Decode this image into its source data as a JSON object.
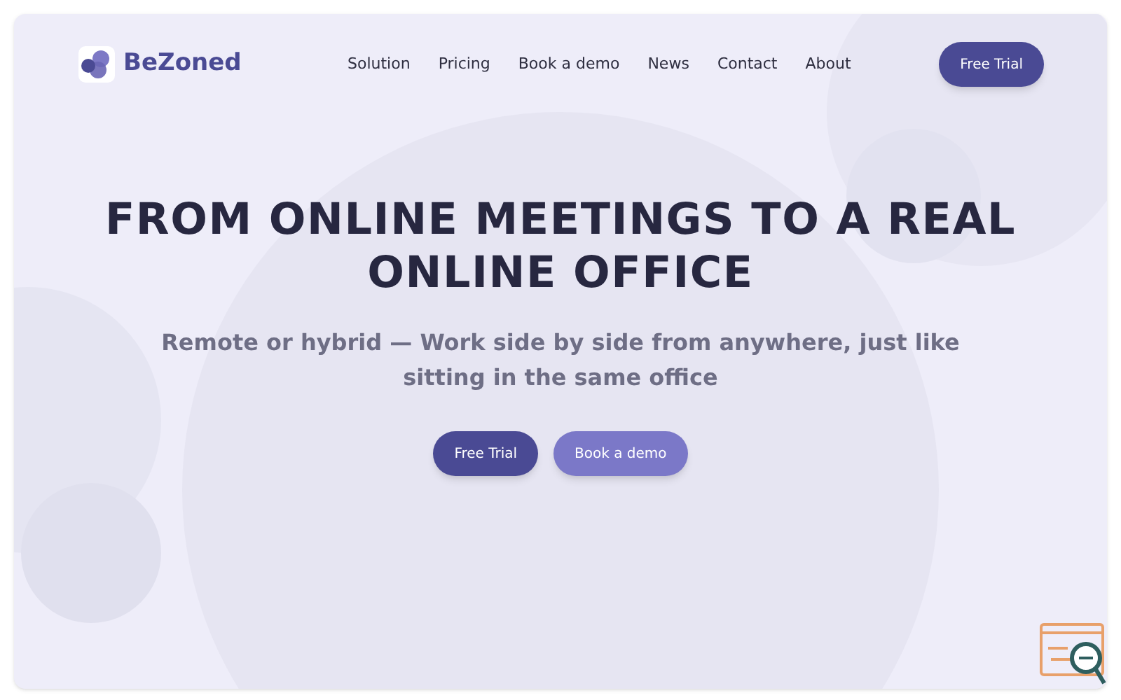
{
  "brand": {
    "name": "BeZoned"
  },
  "nav": {
    "links": [
      "Solution",
      "Pricing",
      "Book a demo",
      "News",
      "Contact",
      "About"
    ],
    "cta": "Free Trial"
  },
  "hero": {
    "title_lines": [
      "FROM ONLINE MEETINGS TO A REAL",
      "ONLINE OFFICE"
    ],
    "subtitle_lines": [
      "Remote or hybrid — Work side by side from anywhere, just like",
      "sitting in the same office"
    ],
    "buttons": [
      {
        "label": "Free Trial",
        "kind": "primary"
      },
      {
        "label": "Book a demo",
        "kind": "secondary"
      }
    ]
  }
}
